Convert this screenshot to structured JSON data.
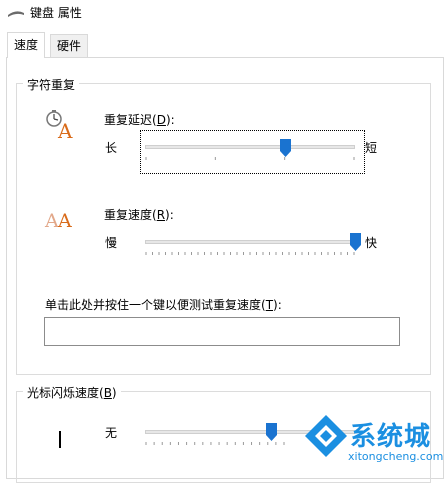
{
  "window": {
    "title": "键盘 属性"
  },
  "tabs": [
    {
      "label": "速度",
      "active": true
    },
    {
      "label": "硬件",
      "active": false
    }
  ],
  "repeat_group": {
    "title": "字符重复",
    "delay": {
      "label": "重复延迟(",
      "access_key": "D",
      "label_end": "):",
      "min_label": "长",
      "max_label": "短",
      "value_fraction": 0.67,
      "tick_count": 4
    },
    "rate": {
      "label": "重复速度(",
      "access_key": "R",
      "label_end": "):",
      "min_label": "慢",
      "max_label": "快",
      "value_fraction": 1.0,
      "tick_count": 33
    },
    "test_label": "单击此处并按住一个键以便测试重复速度(",
    "test_key": "T",
    "test_label_end": "):",
    "test_value": ""
  },
  "cursor_group": {
    "title": "光标闪烁速度(",
    "access_key": "B",
    "title_end": ")",
    "min_label": "无",
    "value_fraction": 0.6
  },
  "watermark": {
    "brand": "系统城",
    "site": "xitongcheng.com"
  },
  "colors": {
    "accent": "#1a73d0",
    "watermark_blue": "#1b8fe1"
  }
}
